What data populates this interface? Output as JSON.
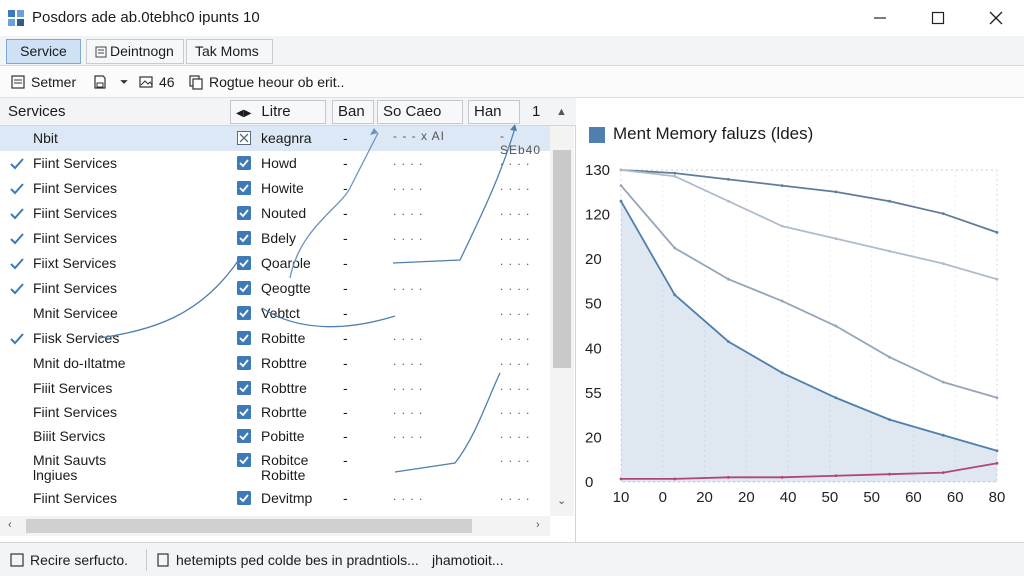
{
  "window": {
    "title": "Posdors ade ab.0tebhc0 ipunts 10",
    "minimize_icon": "minimize-icon",
    "maximize_icon": "maximize-icon",
    "close_icon": "close-icon"
  },
  "tabs": [
    {
      "label": "Service",
      "active": true
    },
    {
      "label": "Deintnogn",
      "active": false
    },
    {
      "label": "Tak Moms",
      "active": false
    }
  ],
  "toolbar": {
    "setmer_label": "Setmer",
    "count_label": "46",
    "description": "Rogtue heour ob erit.."
  },
  "columns": {
    "services": "Services",
    "litre": "Litre",
    "ban": "Ban",
    "so_caeo": "So Caeo",
    "han": "Han",
    "one": "1"
  },
  "rows": [
    {
      "name": "Nbit",
      "checked": false,
      "status": "keagnra",
      "dash": "-",
      "extra1": "- - - x AI",
      "extra2": "- SEb40",
      "selected": true,
      "cb_style": "mixed"
    },
    {
      "name": "Fiint Services",
      "checked": true,
      "status": "Howd",
      "dash": "-",
      "extra1": ". . . .",
      "extra2": ". . . .",
      "cb_style": "checked"
    },
    {
      "name": "Fiint Services",
      "checked": true,
      "status": "Howite",
      "dash": "-",
      "extra1": ". . . .",
      "extra2": ". . . .",
      "cb_style": "checked"
    },
    {
      "name": "Fiint Services",
      "checked": true,
      "status": "Nouted",
      "dash": "-",
      "extra1": ". . . .",
      "extra2": ". . . .",
      "cb_style": "checked"
    },
    {
      "name": "Fiint Services",
      "checked": true,
      "status": "Bdely",
      "dash": "-",
      "extra1": ". . . .",
      "extra2": ". . . .",
      "cb_style": "checked"
    },
    {
      "name": "Fiixt Services",
      "checked": true,
      "status": "Qoarole",
      "dash": "-",
      "extra1": "",
      "extra2": ". . . .",
      "cb_style": "checked"
    },
    {
      "name": "Fiint Services",
      "checked": true,
      "status": "Qeogtte",
      "dash": "-",
      "extra1": ". . . .",
      "extra2": ". . . .",
      "cb_style": "checked"
    },
    {
      "name": "Mnit Servicee",
      "checked": false,
      "status": "Vebtct",
      "dash": "-",
      "extra1": "",
      "extra2": ". . . .",
      "cb_style": "checked"
    },
    {
      "name": "Fiisk Services",
      "checked": true,
      "status": "Robitte",
      "dash": "-",
      "extra1": ". . . .",
      "extra2": ". . . .",
      "cb_style": "checked"
    },
    {
      "name": "Mnit do-ıltatme",
      "checked": false,
      "status": "Robttre",
      "dash": "-",
      "extra1": ". . . .",
      "extra2": ". . . .",
      "cb_style": "checked"
    },
    {
      "name": "Fiiit Services",
      "checked": false,
      "status": "Robttre",
      "dash": "-",
      "extra1": ". . . .",
      "extra2": ". . . .",
      "cb_style": "checked"
    },
    {
      "name": "Fiint Services",
      "checked": false,
      "status": "Robrtte",
      "dash": "-",
      "extra1": ". . . .",
      "extra2": ". . . .",
      "cb_style": "checked"
    },
    {
      "name": "Biiit Servics",
      "checked": false,
      "status": "Pobitte",
      "dash": "-",
      "extra1": ". . . .",
      "extra2": ". . . .",
      "cb_style": "checked"
    },
    {
      "name": "Mnit Sauvts\nlngiues",
      "checked": false,
      "status": "Robitce\nRobitte",
      "dash": "-",
      "extra1": "",
      "extra2": ". . . .",
      "cb_style": "checked",
      "tall": true
    },
    {
      "name": "Fiint Services",
      "checked": false,
      "status": "Devitmp",
      "dash": "-",
      "extra1": ". . . .",
      "extra2": ". . . .",
      "cb_style": "checked"
    }
  ],
  "statusbar": {
    "item1": "Recire serfucto.",
    "item2": "hetemipts ped colde bes in pradntiols...",
    "item3": "jhamotioit..."
  },
  "colors": {
    "accent": "#4f7fae",
    "check": "#3d7ab8",
    "magenta": "#b0457a"
  },
  "chart_data": {
    "type": "line",
    "title": "Ment Memory faluzs (ldes)",
    "y_tick_labels": [
      "130",
      "120",
      "20",
      "50",
      "40",
      "55",
      "20",
      "0"
    ],
    "x_tick_labels": [
      "10",
      "0",
      "20",
      "20",
      "40",
      "50",
      "50",
      "60",
      "60",
      "80"
    ],
    "grid": true,
    "series": [
      {
        "color": "#5f7d99",
        "values": [
          100,
          99,
          97,
          95,
          93,
          90,
          86,
          80
        ]
      },
      {
        "color": "#aebccc",
        "values": [
          100,
          98,
          90,
          82,
          78,
          74,
          70,
          65
        ]
      },
      {
        "color": "#94a6b8",
        "values": [
          95,
          75,
          65,
          58,
          50,
          40,
          32,
          27
        ]
      },
      {
        "color": "#4f7fae",
        "values": [
          90,
          60,
          45,
          35,
          27,
          20,
          15,
          10
        ],
        "filled": true
      },
      {
        "color": "#b0457a",
        "values": [
          1,
          1,
          1.5,
          1.5,
          2,
          2.5,
          3,
          6
        ]
      }
    ]
  }
}
